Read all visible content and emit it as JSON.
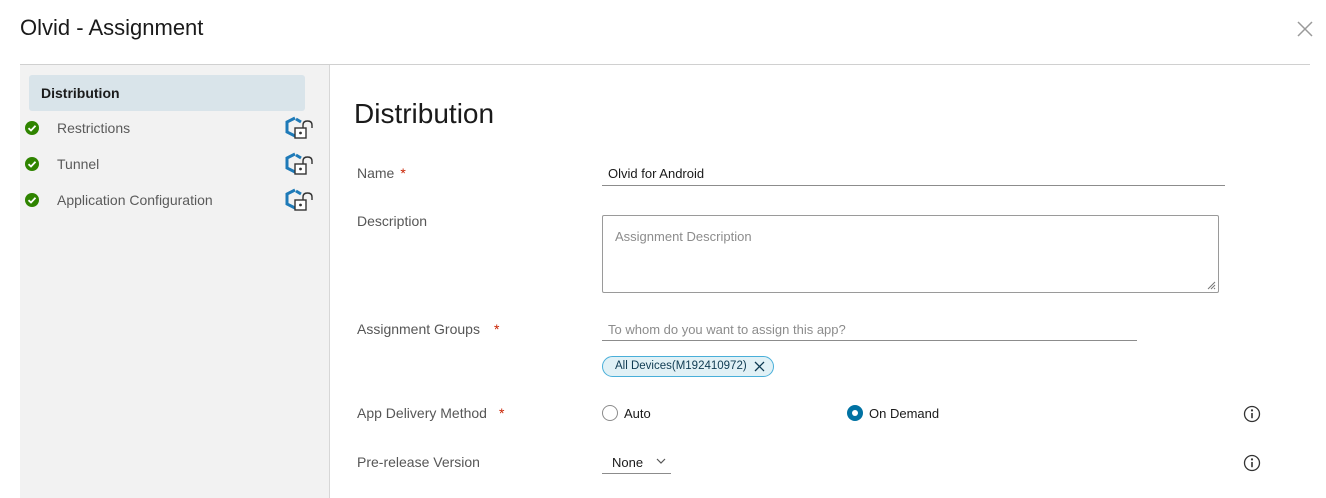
{
  "header": {
    "title": "Olvid - Assignment"
  },
  "sidebar": {
    "active": "Distribution",
    "items": [
      {
        "label": "Restrictions"
      },
      {
        "label": "Tunnel"
      },
      {
        "label": "Application Configuration"
      }
    ]
  },
  "main": {
    "section_title": "Distribution",
    "name": {
      "label": "Name",
      "required": "*",
      "value": "Olvid for Android"
    },
    "description": {
      "label": "Description",
      "placeholder": "Assignment Description"
    },
    "assignment_groups": {
      "label": "Assignment Groups",
      "required": "*",
      "placeholder": "To whom do you want to assign this app?",
      "chips": [
        "All Devices(M192410972)"
      ]
    },
    "delivery_method": {
      "label": "App Delivery Method",
      "required": "*",
      "options": [
        {
          "label": "Auto",
          "selected": false
        },
        {
          "label": "On Demand",
          "selected": true
        }
      ]
    },
    "prerelease": {
      "label": "Pre-release Version",
      "value": "None"
    }
  },
  "colors": {
    "accent": "#0072a3",
    "check_green": "#2f8400",
    "chip_border": "#49afd9",
    "required": "#c92100"
  },
  "icons": [
    "close-icon",
    "check-circle-icon",
    "lock-icon",
    "info-icon",
    "chevron-down-icon",
    "remove-chip-icon"
  ]
}
